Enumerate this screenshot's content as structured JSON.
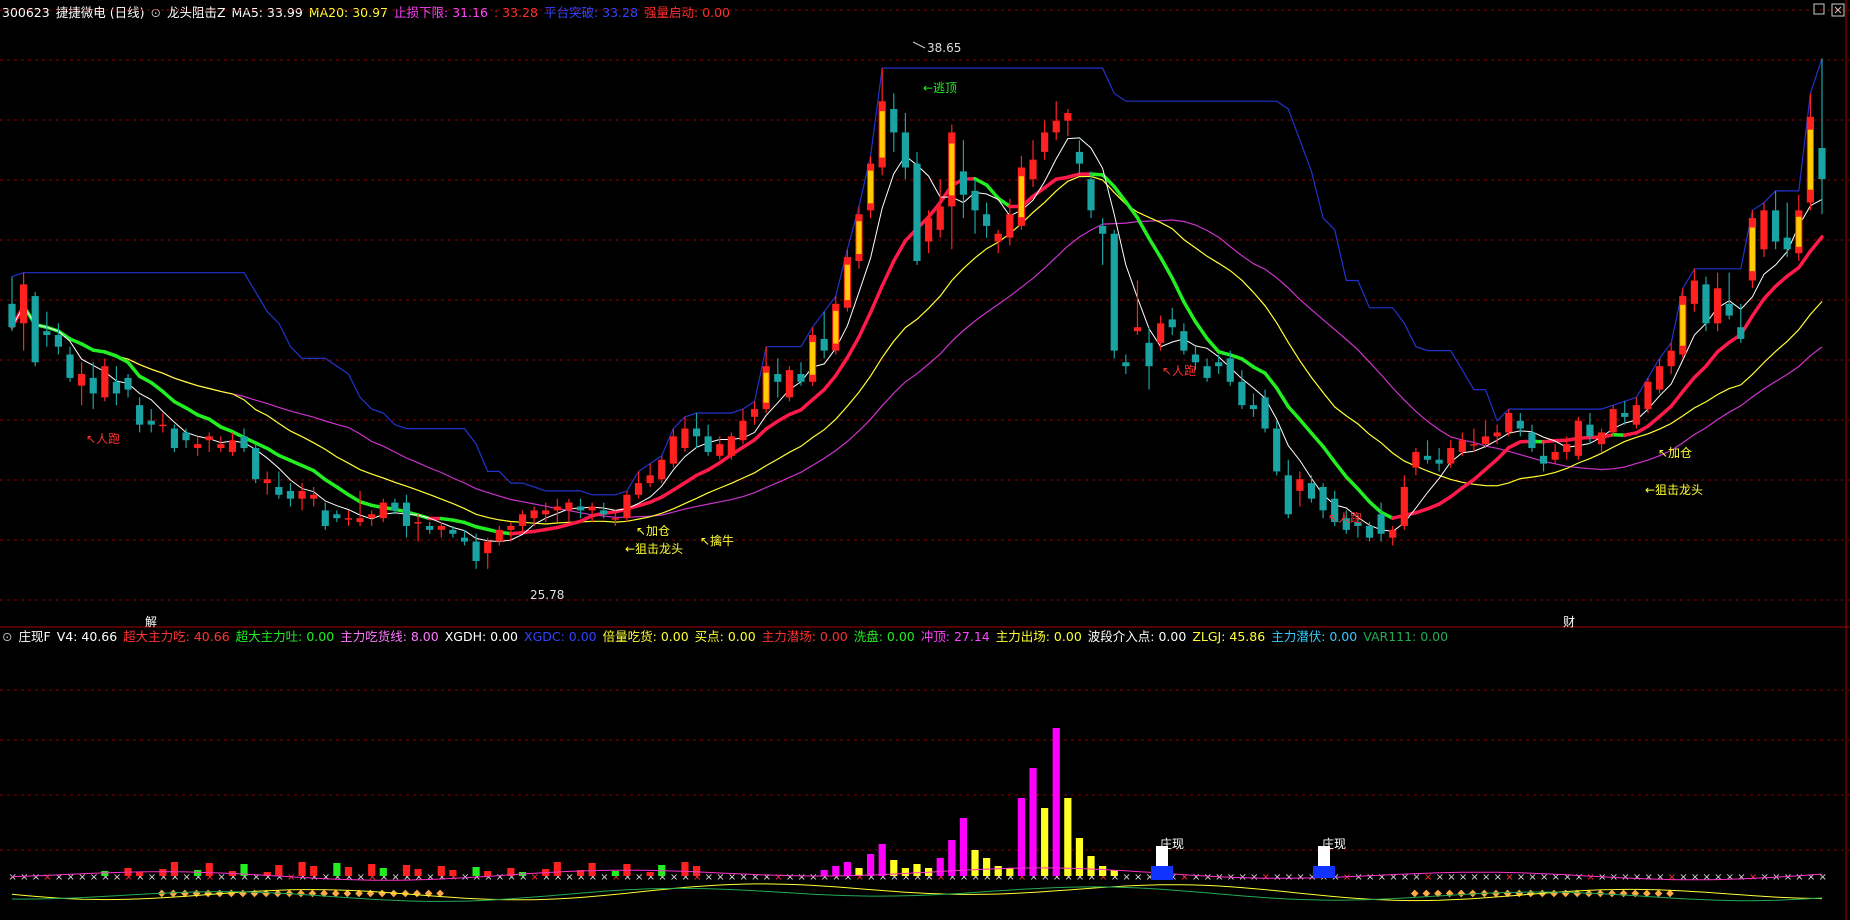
{
  "colors": {
    "background": "#000000",
    "grid": "#8b0000",
    "up_candle": "#ff2020",
    "down_candle": "#1aa3a3",
    "ma5": "#ffffff",
    "ma20": "#ffff33",
    "ma_green": "#22ee22",
    "ma_red": "#ff1a4a",
    "ma_magenta": "#cc33cc",
    "channel_blue": "#2233cc",
    "bar_magenta": "#ff00ff",
    "bar_yellow": "#ffff22"
  },
  "top_legend": {
    "code": "300623",
    "name": "捷捷微电 (日线)",
    "indicator": "龙头阻击Z",
    "ma5": "MA5: 33.99",
    "ma20": "MA20: 30.97",
    "stop_loss": "止损下限: 31.16",
    "stop_value": ": 33.28",
    "platform": "平台突破: 33.28",
    "volume_start": "强量启动: 0.00"
  },
  "bottom_legend": {
    "indicator": "庄现F",
    "v4": "V4: 40.66",
    "super_eat": "超大主力吃: 40.66",
    "super_spit": "超大主力吐: 0.00",
    "main_line": "主力吃货线: 8.00",
    "xgdh": "XGDH: 0.00",
    "xgdc": "XGDC: 0.00",
    "double_eat": "倍量吃货: 0.00",
    "buy_point": "买点: 0.00",
    "main_in": "主力潜场: 0.00",
    "wash": "洗盘: 0.00",
    "rush": "冲顶: 27.14",
    "main_out": "主力出场: 0.00",
    "wave_point": "波段介入点: 0.00",
    "zlgj": "ZLGJ: 45.86",
    "main_latent": "主力潜伏: 0.00",
    "var111": "VAR111: 0.00"
  },
  "annotations": {
    "price_high": "38.65",
    "price_low": "25.78",
    "escape_top": "←逃顶",
    "ren_pao_1": "↖人跑",
    "ren_pao_2": "↖人跑",
    "ren_pao_3": "↖人跑",
    "add_pos_1": "↖加仓",
    "snipe_1": "←狙击龙头",
    "catch_bull": "↖擒牛",
    "add_pos_2": "↖加仓",
    "snipe_2": "←狙击龙头",
    "marker_jie": "解",
    "marker_cai": "财",
    "zhuang_xian_1": "庄现",
    "zhuang_xian_2": "庄现"
  },
  "chart_data": {
    "type": "candlestick",
    "ylim": [
      25.0,
      39.5
    ],
    "candles": [
      {
        "o": 32.6,
        "h": 33.3,
        "l": 31.9,
        "c": 32.0
      },
      {
        "o": 32.1,
        "h": 33.4,
        "l": 31.4,
        "c": 33.1
      },
      {
        "o": 32.8,
        "h": 32.9,
        "l": 31.0,
        "c": 31.1
      },
      {
        "o": 31.9,
        "h": 32.4,
        "l": 31.5,
        "c": 31.8
      },
      {
        "o": 31.8,
        "h": 32.1,
        "l": 31.3,
        "c": 31.5
      },
      {
        "o": 31.3,
        "h": 31.5,
        "l": 30.6,
        "c": 30.7
      },
      {
        "o": 30.5,
        "h": 31.1,
        "l": 30.0,
        "c": 30.8
      },
      {
        "o": 30.7,
        "h": 31.1,
        "l": 29.9,
        "c": 30.3
      },
      {
        "o": 30.2,
        "h": 31.2,
        "l": 30.1,
        "c": 31.0
      },
      {
        "o": 30.6,
        "h": 31.0,
        "l": 30.0,
        "c": 30.3
      },
      {
        "o": 30.7,
        "h": 30.8,
        "l": 30.2,
        "c": 30.4
      },
      {
        "o": 30.0,
        "h": 30.2,
        "l": 29.3,
        "c": 29.5
      },
      {
        "o": 29.6,
        "h": 29.9,
        "l": 29.3,
        "c": 29.5
      },
      {
        "o": 29.5,
        "h": 29.8,
        "l": 29.3,
        "c": 29.5
      },
      {
        "o": 29.4,
        "h": 29.5,
        "l": 28.8,
        "c": 28.9
      },
      {
        "o": 29.3,
        "h": 29.4,
        "l": 28.9,
        "c": 29.1
      },
      {
        "o": 28.9,
        "h": 29.2,
        "l": 28.7,
        "c": 29.0
      },
      {
        "o": 29.1,
        "h": 29.3,
        "l": 28.8,
        "c": 29.2
      },
      {
        "o": 28.9,
        "h": 29.2,
        "l": 28.8,
        "c": 29.0
      },
      {
        "o": 28.8,
        "h": 29.3,
        "l": 28.7,
        "c": 29.1
      },
      {
        "o": 29.2,
        "h": 29.4,
        "l": 28.8,
        "c": 28.9
      },
      {
        "o": 28.9,
        "h": 29.0,
        "l": 28.0,
        "c": 28.1
      },
      {
        "o": 28.0,
        "h": 28.3,
        "l": 27.7,
        "c": 28.1
      },
      {
        "o": 27.9,
        "h": 28.3,
        "l": 27.6,
        "c": 27.7
      },
      {
        "o": 27.8,
        "h": 28.0,
        "l": 27.4,
        "c": 27.6
      },
      {
        "o": 27.6,
        "h": 28.0,
        "l": 27.3,
        "c": 27.8
      },
      {
        "o": 27.6,
        "h": 27.9,
        "l": 27.4,
        "c": 27.7
      },
      {
        "o": 27.3,
        "h": 27.5,
        "l": 26.8,
        "c": 26.9
      },
      {
        "o": 27.2,
        "h": 27.3,
        "l": 27.0,
        "c": 27.1
      },
      {
        "o": 27.1,
        "h": 27.3,
        "l": 26.9,
        "c": 27.1
      },
      {
        "o": 27.0,
        "h": 27.8,
        "l": 26.9,
        "c": 27.1
      },
      {
        "o": 27.1,
        "h": 27.3,
        "l": 26.9,
        "c": 27.2
      },
      {
        "o": 27.1,
        "h": 27.6,
        "l": 27.0,
        "c": 27.5
      },
      {
        "o": 27.5,
        "h": 27.6,
        "l": 27.2,
        "c": 27.3
      },
      {
        "o": 27.5,
        "h": 27.7,
        "l": 26.6,
        "c": 26.9
      },
      {
        "o": 27.0,
        "h": 27.2,
        "l": 26.5,
        "c": 27.0
      },
      {
        "o": 26.9,
        "h": 27.0,
        "l": 26.7,
        "c": 26.8
      },
      {
        "o": 26.8,
        "h": 27.0,
        "l": 26.6,
        "c": 26.9
      },
      {
        "o": 26.8,
        "h": 26.9,
        "l": 26.6,
        "c": 26.7
      },
      {
        "o": 26.6,
        "h": 26.8,
        "l": 26.4,
        "c": 26.5
      },
      {
        "o": 26.5,
        "h": 26.7,
        "l": 25.8,
        "c": 26.0
      },
      {
        "o": 26.2,
        "h": 26.6,
        "l": 25.8,
        "c": 26.5
      },
      {
        "o": 26.5,
        "h": 26.9,
        "l": 26.4,
        "c": 26.8
      },
      {
        "o": 26.8,
        "h": 27.0,
        "l": 26.5,
        "c": 26.9
      },
      {
        "o": 26.9,
        "h": 27.3,
        "l": 26.7,
        "c": 27.2
      },
      {
        "o": 27.1,
        "h": 27.4,
        "l": 26.9,
        "c": 27.3
      },
      {
        "o": 27.2,
        "h": 27.5,
        "l": 27.0,
        "c": 27.3
      },
      {
        "o": 27.3,
        "h": 27.6,
        "l": 27.0,
        "c": 27.4
      },
      {
        "o": 27.3,
        "h": 27.6,
        "l": 27.0,
        "c": 27.5
      },
      {
        "o": 27.4,
        "h": 27.6,
        "l": 27.1,
        "c": 27.3
      },
      {
        "o": 27.3,
        "h": 27.5,
        "l": 27.0,
        "c": 27.4
      },
      {
        "o": 27.3,
        "h": 27.5,
        "l": 27.1,
        "c": 27.2
      },
      {
        "o": 27.1,
        "h": 27.3,
        "l": 26.9,
        "c": 27.1
      },
      {
        "o": 27.1,
        "h": 27.8,
        "l": 27.0,
        "c": 27.7
      },
      {
        "o": 27.7,
        "h": 28.3,
        "l": 27.6,
        "c": 28.0
      },
      {
        "o": 28.0,
        "h": 28.5,
        "l": 27.9,
        "c": 28.2
      },
      {
        "o": 28.1,
        "h": 28.7,
        "l": 28.0,
        "c": 28.6
      },
      {
        "o": 28.5,
        "h": 29.4,
        "l": 28.4,
        "c": 29.2
      },
      {
        "o": 28.9,
        "h": 29.7,
        "l": 28.8,
        "c": 29.4
      },
      {
        "o": 29.4,
        "h": 29.8,
        "l": 28.9,
        "c": 29.2
      },
      {
        "o": 29.2,
        "h": 29.5,
        "l": 28.7,
        "c": 28.8
      },
      {
        "o": 28.7,
        "h": 29.2,
        "l": 28.6,
        "c": 29.0
      },
      {
        "o": 28.7,
        "h": 29.3,
        "l": 28.6,
        "c": 29.2
      },
      {
        "o": 29.1,
        "h": 29.9,
        "l": 29.0,
        "c": 29.6
      },
      {
        "o": 29.7,
        "h": 30.1,
        "l": 29.5,
        "c": 29.9
      },
      {
        "o": 29.9,
        "h": 31.5,
        "l": 29.8,
        "c": 31.0
      },
      {
        "o": 30.8,
        "h": 31.2,
        "l": 30.2,
        "c": 30.6
      },
      {
        "o": 30.2,
        "h": 31.0,
        "l": 30.1,
        "c": 30.9
      },
      {
        "o": 30.8,
        "h": 31.1,
        "l": 30.5,
        "c": 30.6
      },
      {
        "o": 30.6,
        "h": 32.0,
        "l": 30.5,
        "c": 31.8
      },
      {
        "o": 31.7,
        "h": 32.4,
        "l": 31.2,
        "c": 31.4
      },
      {
        "o": 31.4,
        "h": 32.8,
        "l": 31.3,
        "c": 32.6
      },
      {
        "o": 32.5,
        "h": 34.0,
        "l": 32.4,
        "c": 33.8
      },
      {
        "o": 33.7,
        "h": 35.1,
        "l": 33.5,
        "c": 34.9
      },
      {
        "o": 35.0,
        "h": 36.4,
        "l": 34.8,
        "c": 36.2
      },
      {
        "o": 36.1,
        "h": 38.65,
        "l": 35.9,
        "c": 37.8
      },
      {
        "o": 37.6,
        "h": 38.0,
        "l": 36.5,
        "c": 37.0
      },
      {
        "o": 37.0,
        "h": 37.5,
        "l": 35.8,
        "c": 36.1
      },
      {
        "o": 36.2,
        "h": 36.5,
        "l": 33.6,
        "c": 33.7
      },
      {
        "o": 34.2,
        "h": 35.0,
        "l": 33.9,
        "c": 34.8
      },
      {
        "o": 34.5,
        "h": 35.8,
        "l": 34.3,
        "c": 35.1
      },
      {
        "o": 35.1,
        "h": 37.2,
        "l": 34.0,
        "c": 37.0
      },
      {
        "o": 36.0,
        "h": 36.8,
        "l": 34.8,
        "c": 35.4
      },
      {
        "o": 35.5,
        "h": 35.8,
        "l": 34.4,
        "c": 35.0
      },
      {
        "o": 34.9,
        "h": 35.2,
        "l": 34.3,
        "c": 34.6
      },
      {
        "o": 34.2,
        "h": 34.5,
        "l": 33.9,
        "c": 34.4
      },
      {
        "o": 34.3,
        "h": 35.3,
        "l": 34.1,
        "c": 34.9
      },
      {
        "o": 34.6,
        "h": 36.4,
        "l": 34.5,
        "c": 36.1
      },
      {
        "o": 35.8,
        "h": 36.8,
        "l": 35.6,
        "c": 36.3
      },
      {
        "o": 36.5,
        "h": 37.3,
        "l": 36.3,
        "c": 37.0
      },
      {
        "o": 37.0,
        "h": 37.8,
        "l": 36.8,
        "c": 37.3
      },
      {
        "o": 37.3,
        "h": 37.6,
        "l": 36.9,
        "c": 37.5
      },
      {
        "o": 36.5,
        "h": 36.8,
        "l": 35.9,
        "c": 36.2
      },
      {
        "o": 35.8,
        "h": 36.0,
        "l": 34.8,
        "c": 35.0
      },
      {
        "o": 34.6,
        "h": 34.8,
        "l": 33.6,
        "c": 34.4
      },
      {
        "o": 34.4,
        "h": 34.5,
        "l": 31.2,
        "c": 31.4
      },
      {
        "o": 31.1,
        "h": 31.3,
        "l": 30.8,
        "c": 31.0
      },
      {
        "o": 31.9,
        "h": 33.2,
        "l": 31.8,
        "c": 32.0
      },
      {
        "o": 31.6,
        "h": 32.0,
        "l": 30.4,
        "c": 31.0
      },
      {
        "o": 31.6,
        "h": 32.3,
        "l": 31.4,
        "c": 32.1
      },
      {
        "o": 32.2,
        "h": 32.5,
        "l": 31.8,
        "c": 32.0
      },
      {
        "o": 31.9,
        "h": 32.1,
        "l": 31.3,
        "c": 31.4
      },
      {
        "o": 31.3,
        "h": 31.5,
        "l": 30.9,
        "c": 31.1
      },
      {
        "o": 31.0,
        "h": 31.2,
        "l": 30.6,
        "c": 30.7
      },
      {
        "o": 31.1,
        "h": 31.3,
        "l": 30.8,
        "c": 31.0
      },
      {
        "o": 31.2,
        "h": 31.4,
        "l": 30.5,
        "c": 30.6
      },
      {
        "o": 30.6,
        "h": 30.9,
        "l": 29.9,
        "c": 30.0
      },
      {
        "o": 30.0,
        "h": 30.3,
        "l": 29.7,
        "c": 29.9
      },
      {
        "o": 30.2,
        "h": 30.4,
        "l": 29.3,
        "c": 29.4
      },
      {
        "o": 29.4,
        "h": 29.6,
        "l": 28.2,
        "c": 28.3
      },
      {
        "o": 28.2,
        "h": 28.6,
        "l": 27.1,
        "c": 27.2
      },
      {
        "o": 27.8,
        "h": 28.3,
        "l": 27.4,
        "c": 28.1
      },
      {
        "o": 28.0,
        "h": 28.2,
        "l": 27.5,
        "c": 27.6
      },
      {
        "o": 27.9,
        "h": 28.0,
        "l": 27.1,
        "c": 27.3
      },
      {
        "o": 27.6,
        "h": 27.8,
        "l": 26.9,
        "c": 27.0
      },
      {
        "o": 27.1,
        "h": 27.3,
        "l": 26.7,
        "c": 26.8
      },
      {
        "o": 27.0,
        "h": 27.2,
        "l": 26.6,
        "c": 26.9
      },
      {
        "o": 26.9,
        "h": 27.0,
        "l": 26.5,
        "c": 26.6
      },
      {
        "o": 27.2,
        "h": 27.5,
        "l": 26.5,
        "c": 26.7
      },
      {
        "o": 26.6,
        "h": 26.9,
        "l": 26.4,
        "c": 26.8
      },
      {
        "o": 26.9,
        "h": 28.2,
        "l": 26.8,
        "c": 27.9
      },
      {
        "o": 28.4,
        "h": 28.9,
        "l": 28.2,
        "c": 28.8
      },
      {
        "o": 28.7,
        "h": 29.1,
        "l": 28.5,
        "c": 28.6
      },
      {
        "o": 28.6,
        "h": 28.9,
        "l": 28.3,
        "c": 28.5
      },
      {
        "o": 28.5,
        "h": 29.1,
        "l": 28.4,
        "c": 28.9
      },
      {
        "o": 28.8,
        "h": 29.3,
        "l": 28.7,
        "c": 29.1
      },
      {
        "o": 29.0,
        "h": 29.4,
        "l": 28.8,
        "c": 29.0
      },
      {
        "o": 29.0,
        "h": 29.6,
        "l": 28.9,
        "c": 29.2
      },
      {
        "o": 29.2,
        "h": 29.5,
        "l": 29.0,
        "c": 29.3
      },
      {
        "o": 29.3,
        "h": 29.9,
        "l": 29.2,
        "c": 29.8
      },
      {
        "o": 29.6,
        "h": 29.8,
        "l": 29.2,
        "c": 29.4
      },
      {
        "o": 29.3,
        "h": 29.5,
        "l": 28.8,
        "c": 28.9
      },
      {
        "o": 28.7,
        "h": 29.1,
        "l": 28.3,
        "c": 28.5
      },
      {
        "o": 28.6,
        "h": 29.0,
        "l": 28.5,
        "c": 28.8
      },
      {
        "o": 28.8,
        "h": 29.2,
        "l": 28.6,
        "c": 29.0
      },
      {
        "o": 28.7,
        "h": 29.7,
        "l": 28.6,
        "c": 29.6
      },
      {
        "o": 29.5,
        "h": 29.8,
        "l": 29.0,
        "c": 29.2
      },
      {
        "o": 29.0,
        "h": 29.4,
        "l": 28.8,
        "c": 29.3
      },
      {
        "o": 29.3,
        "h": 30.0,
        "l": 29.2,
        "c": 29.9
      },
      {
        "o": 29.8,
        "h": 30.1,
        "l": 29.5,
        "c": 29.7
      },
      {
        "o": 29.5,
        "h": 30.2,
        "l": 29.4,
        "c": 30.0
      },
      {
        "o": 29.9,
        "h": 30.7,
        "l": 29.8,
        "c": 30.6
      },
      {
        "o": 30.4,
        "h": 31.2,
        "l": 30.3,
        "c": 31.0
      },
      {
        "o": 31.0,
        "h": 31.6,
        "l": 30.8,
        "c": 31.4
      },
      {
        "o": 31.3,
        "h": 33.0,
        "l": 31.2,
        "c": 32.8
      },
      {
        "o": 32.6,
        "h": 33.5,
        "l": 32.4,
        "c": 33.2
      },
      {
        "o": 33.1,
        "h": 33.3,
        "l": 31.9,
        "c": 32.1
      },
      {
        "o": 32.1,
        "h": 33.4,
        "l": 31.9,
        "c": 33.0
      },
      {
        "o": 32.6,
        "h": 33.4,
        "l": 32.2,
        "c": 32.3
      },
      {
        "o": 32.0,
        "h": 32.6,
        "l": 31.6,
        "c": 31.7
      },
      {
        "o": 33.2,
        "h": 35.0,
        "l": 33.0,
        "c": 34.8
      },
      {
        "o": 34.0,
        "h": 35.2,
        "l": 33.8,
        "c": 35.0
      },
      {
        "o": 35.0,
        "h": 35.5,
        "l": 34.0,
        "c": 34.2
      },
      {
        "o": 34.3,
        "h": 35.2,
        "l": 33.8,
        "c": 34.0
      },
      {
        "o": 33.9,
        "h": 35.4,
        "l": 33.7,
        "c": 35.0
      },
      {
        "o": 35.2,
        "h": 38.0,
        "l": 35.0,
        "c": 37.4
      },
      {
        "o": 36.6,
        "h": 38.9,
        "l": 34.9,
        "c": 35.8
      }
    ]
  },
  "lower_chart": {
    "bars": [
      {
        "i": 70,
        "v": 6,
        "c": "magenta"
      },
      {
        "i": 71,
        "v": 10,
        "c": "magenta"
      },
      {
        "i": 72,
        "v": 14,
        "c": "magenta"
      },
      {
        "i": 73,
        "v": 8,
        "c": "yellow"
      },
      {
        "i": 74,
        "v": 22,
        "c": "magenta"
      },
      {
        "i": 75,
        "v": 32,
        "c": "magenta"
      },
      {
        "i": 76,
        "v": 16,
        "c": "yellow"
      },
      {
        "i": 77,
        "v": 8,
        "c": "yellow"
      },
      {
        "i": 78,
        "v": 12,
        "c": "yellow"
      },
      {
        "i": 79,
        "v": 8,
        "c": "yellow"
      },
      {
        "i": 80,
        "v": 18,
        "c": "magenta"
      },
      {
        "i": 81,
        "v": 36,
        "c": "magenta"
      },
      {
        "i": 82,
        "v": 58,
        "c": "magenta"
      },
      {
        "i": 83,
        "v": 26,
        "c": "yellow"
      },
      {
        "i": 84,
        "v": 18,
        "c": "yellow"
      },
      {
        "i": 85,
        "v": 10,
        "c": "yellow"
      },
      {
        "i": 86,
        "v": 8,
        "c": "yellow"
      },
      {
        "i": 87,
        "v": 78,
        "c": "magenta"
      },
      {
        "i": 88,
        "v": 108,
        "c": "magenta"
      },
      {
        "i": 89,
        "v": 68,
        "c": "yellow"
      },
      {
        "i": 90,
        "v": 148,
        "c": "magenta"
      },
      {
        "i": 91,
        "v": 78,
        "c": "yellow"
      },
      {
        "i": 92,
        "v": 38,
        "c": "yellow"
      },
      {
        "i": 93,
        "v": 20,
        "c": "yellow"
      },
      {
        "i": 94,
        "v": 10,
        "c": "yellow"
      },
      {
        "i": 95,
        "v": 6,
        "c": "yellow"
      }
    ]
  }
}
